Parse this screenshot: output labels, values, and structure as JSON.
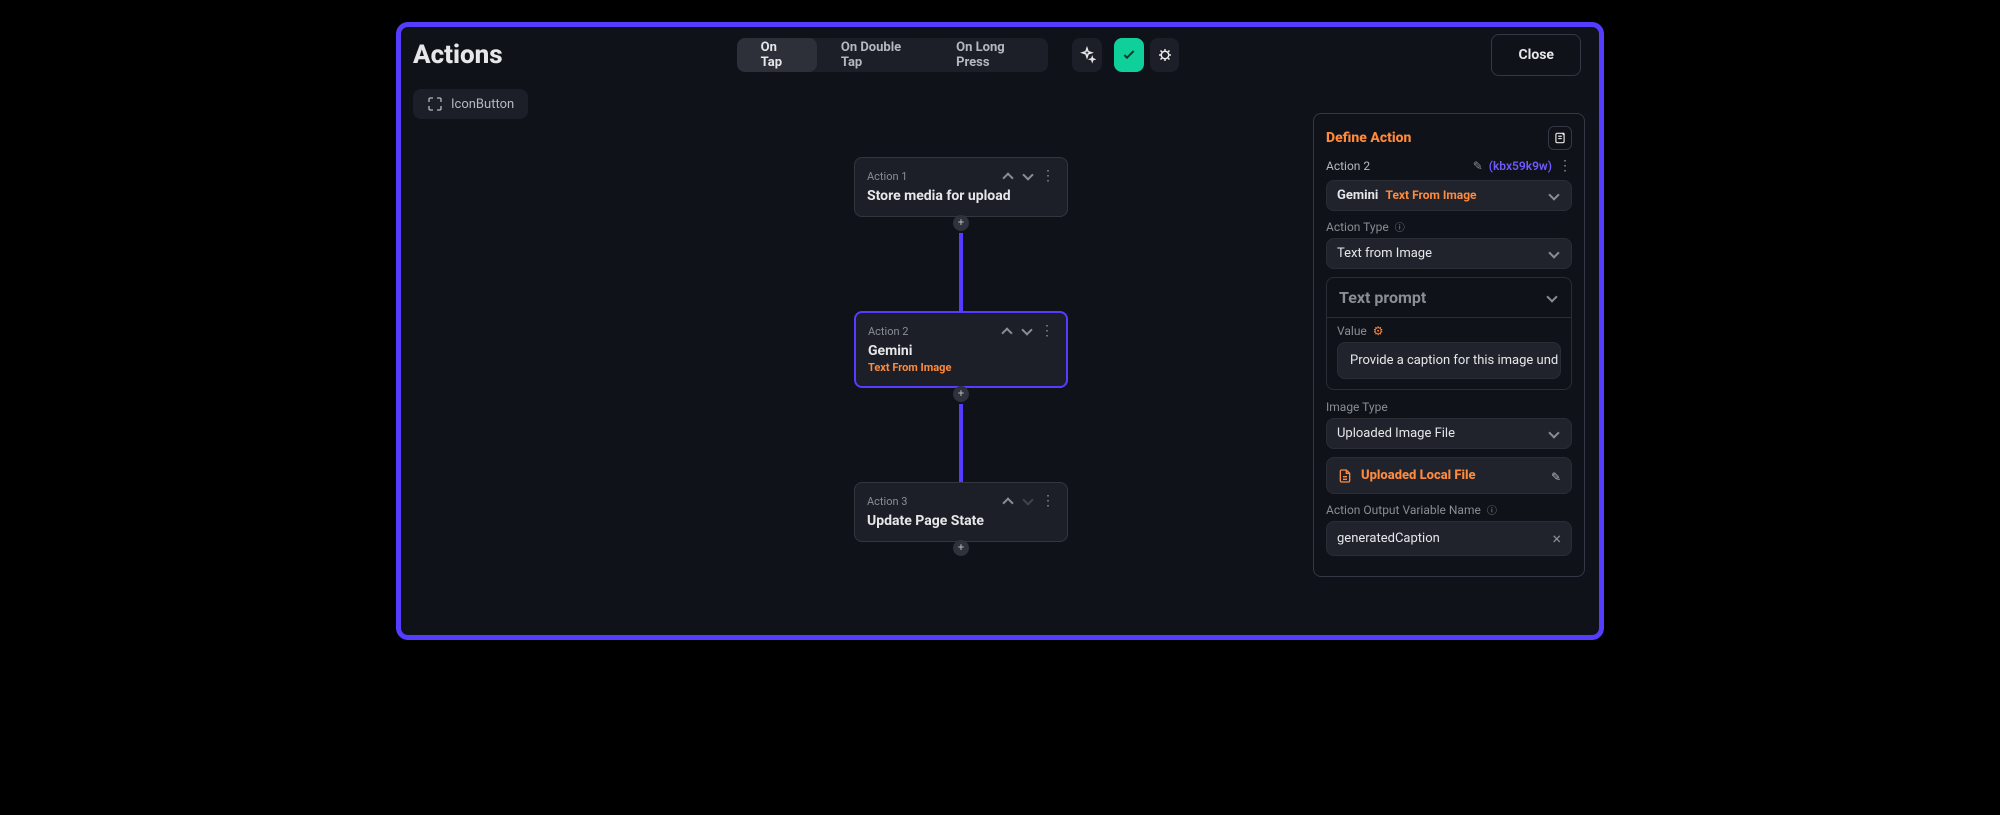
{
  "header": {
    "title": "Actions",
    "close_label": "Close",
    "tabs": [
      "On Tap",
      "On Double Tap",
      "On Long Press"
    ],
    "active_tab": 0,
    "chip_label": "IconButton"
  },
  "nodes": [
    {
      "label": "Action 1",
      "title": "Store media for upload",
      "subtitle": "",
      "selected": false,
      "up": true,
      "down": true
    },
    {
      "label": "Action 2",
      "title": "Gemini",
      "subtitle": "Text From Image",
      "selected": true,
      "up": true,
      "down": true
    },
    {
      "label": "Action 3",
      "title": "Update Page State",
      "subtitle": "",
      "selected": false,
      "up": true,
      "down": false
    }
  ],
  "panel": {
    "title": "Define Action",
    "action_label": "Action 2",
    "action_id": "(kbx59k9w)",
    "action_name_primary": "Gemini",
    "action_name_secondary": "Text From Image",
    "action_type_label": "Action Type",
    "action_type_value": "Text from Image",
    "prompt_section": "Text prompt",
    "value_label": "Value",
    "prompt_value": "Provide a caption for this image und",
    "image_type_label": "Image Type",
    "image_type_value": "Uploaded Image File",
    "file_label": "Uploaded Local File",
    "output_var_label": "Action Output Variable Name",
    "output_var_value": "generatedCaption"
  }
}
